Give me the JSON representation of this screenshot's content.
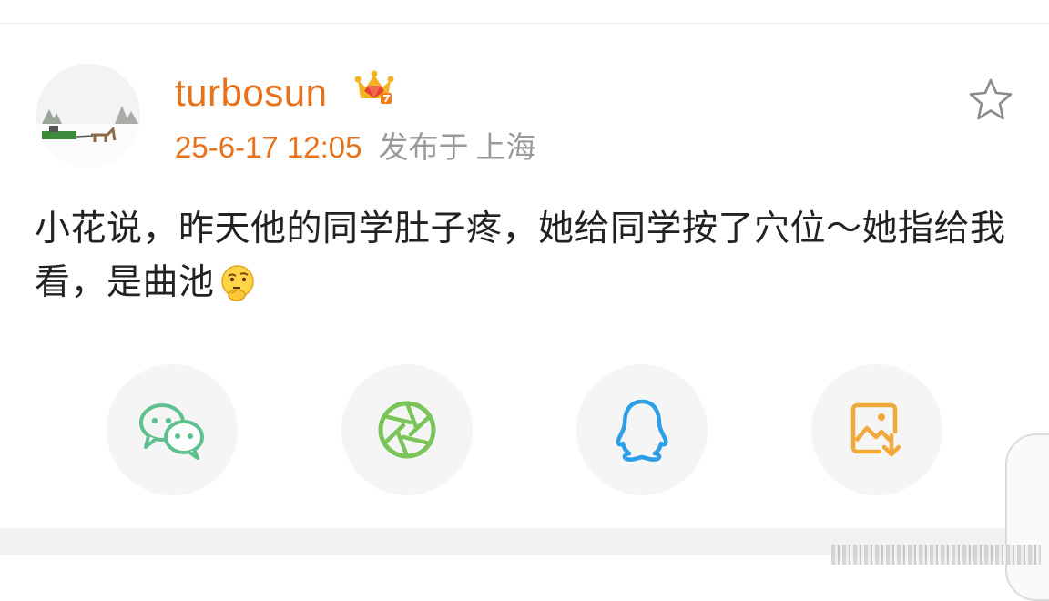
{
  "post": {
    "username": "turbosun",
    "timestamp": "25-6-17 12:05",
    "posted_label": "发布于",
    "location": "上海",
    "text": "小花说，昨天他的同学肚子疼，她给同学按了穴位～她指给我看，是曲池",
    "badge_icon": "crown-icon",
    "emoji_icon": "thinking-emoji-icon"
  },
  "actions": {
    "favorite_icon": "star-icon"
  },
  "share": [
    {
      "icon": "wechat-icon",
      "color": "#5ec08f"
    },
    {
      "icon": "moments-aperture-icon",
      "color": "#7ac45a"
    },
    {
      "icon": "qq-icon",
      "color": "#2d9ee8"
    },
    {
      "icon": "save-image-icon",
      "color": "#f2a93b"
    }
  ],
  "colors": {
    "accent": "#e8711c",
    "meta_gray": "#999999",
    "text": "#222222"
  }
}
